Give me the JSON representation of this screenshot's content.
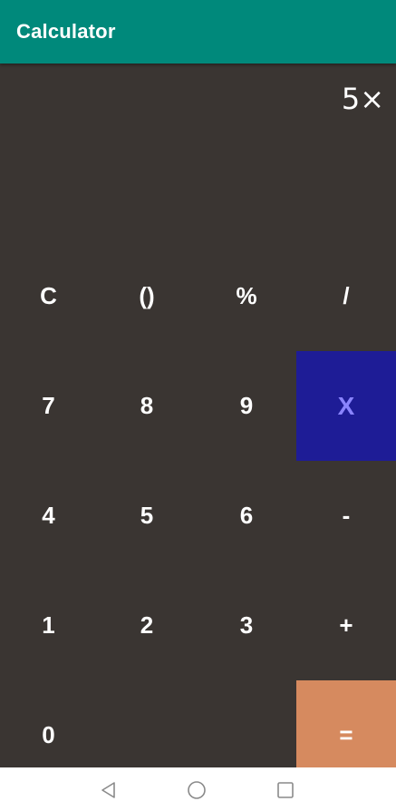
{
  "toolbar": {
    "title": "Calculator",
    "background": "#00897b"
  },
  "display": {
    "expression": "5×"
  },
  "keypad": {
    "rows": [
      [
        "C",
        "()",
        "%",
        "/"
      ],
      [
        "7",
        "8",
        "9",
        "X"
      ],
      [
        "4",
        "5",
        "6",
        "-"
      ],
      [
        "1",
        "2",
        "3",
        "+"
      ],
      [
        "0",
        ".",
        "",
        "="
      ]
    ],
    "active_key": "X",
    "colors": {
      "background": "#3a3532",
      "active_operator": "#1e1c96",
      "active_operator_text": "#8a84ff",
      "equals": "#d68a5f"
    }
  },
  "navbar": {
    "icons": [
      "back-triangle-icon",
      "home-circle-icon",
      "recents-square-icon"
    ]
  }
}
